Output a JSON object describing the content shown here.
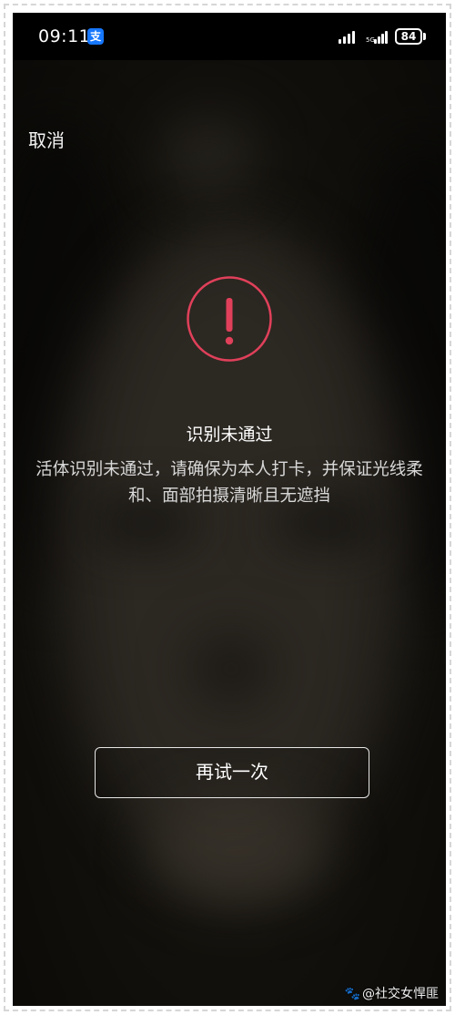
{
  "status_bar": {
    "time": "09:11",
    "app_badge": "支",
    "network_label": "5G",
    "battery": "84"
  },
  "header": {
    "cancel_label": "取消"
  },
  "alert": {
    "icon": "exclamation-circle-icon",
    "icon_color": "#e0405a",
    "title": "识别未通过",
    "message": "活体识别未通过，请确保为本人打卡，并保证光线柔和、面部拍摄清晰且无遮挡"
  },
  "actions": {
    "retry_label": "再试一次"
  },
  "watermark": {
    "text": "@社交女悍匪"
  }
}
